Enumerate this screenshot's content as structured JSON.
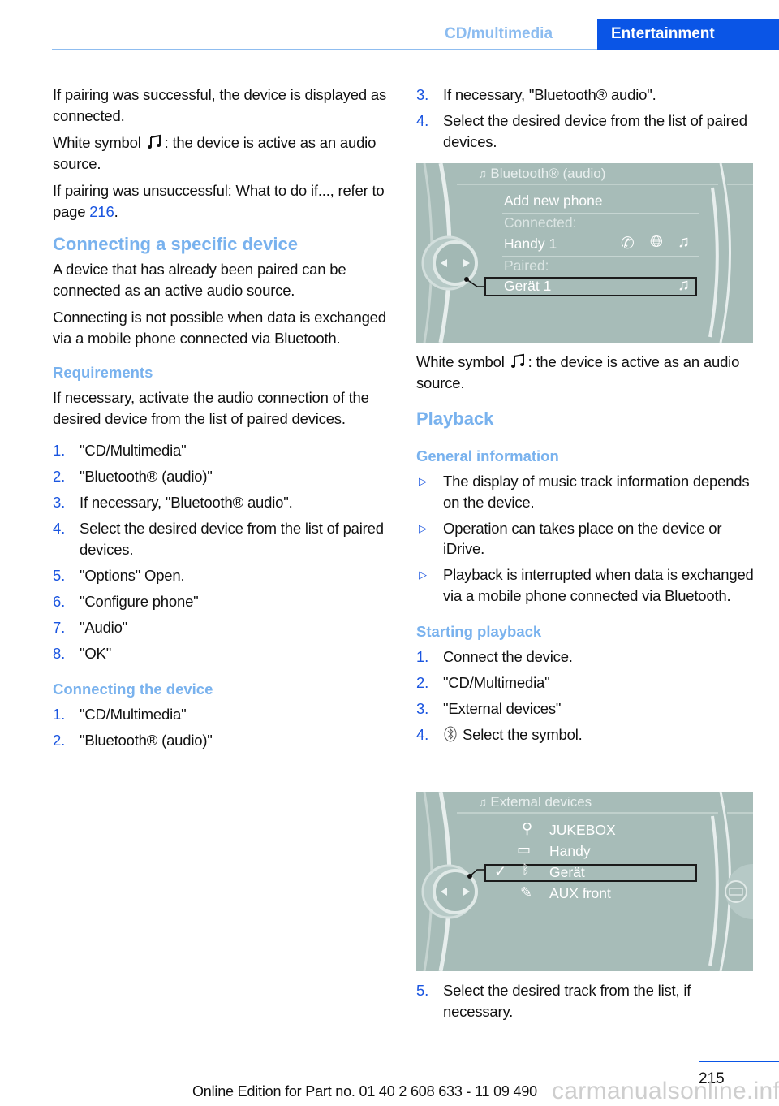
{
  "header": {
    "section": "CD/multimedia",
    "chapter_tab": "Entertainment"
  },
  "left": {
    "p1": "If pairing was successful, the device is displayed as connected.",
    "p2_before": "White symbol",
    "p2_after": ": the device is active as an audio source.",
    "p3_before": "If pairing was unsuccessful: What to do if..., refer to page ",
    "p3_link": "216",
    "p3_after": ".",
    "h_specific": "Connecting a specific device",
    "p4": "A device that has already been paired can be connected as an active audio source.",
    "p5": "Connecting is not possible when data is exchanged via a mobile phone connected via Bluetooth.",
    "h_requirements": "Requirements",
    "p6": "If necessary, activate the audio connection of the desired device from the list of paired devices.",
    "req_steps": [
      {
        "num": "1.",
        "text": "\"CD/Multimedia\""
      },
      {
        "num": "2.",
        "text": "\"Bluetooth® (audio)\""
      },
      {
        "num": "3.",
        "text": "If necessary, \"Bluetooth® audio\"."
      },
      {
        "num": "4.",
        "text": "Select the desired device from the list of paired devices."
      },
      {
        "num": "5.",
        "text": "\"Options\" Open."
      },
      {
        "num": "6.",
        "text": "\"Configure phone\""
      },
      {
        "num": "7.",
        "text": "\"Audio\""
      },
      {
        "num": "8.",
        "text": "\"OK\""
      }
    ],
    "h_connecting": "Connecting the device",
    "conn_steps": [
      {
        "num": "1.",
        "text": "\"CD/Multimedia\""
      },
      {
        "num": "2.",
        "text": "\"Bluetooth® (audio)\""
      }
    ]
  },
  "right": {
    "conn_steps_cont": [
      {
        "num": "3.",
        "text": "If necessary, \"Bluetooth® audio\"."
      },
      {
        "num": "4.",
        "text": "Select the desired device from the list of paired devices."
      }
    ],
    "screen1": {
      "title": "Bluetooth® (audio)",
      "add_new": "Add new phone",
      "connected_label": "Connected:",
      "connected_device": "Handy 1",
      "paired_label": "Paired:",
      "paired_device": "Gerät 1"
    },
    "p_white_before": "White symbol",
    "p_white_after": ": the device is active as an audio source.",
    "h_playback": "Playback",
    "h_general": "General information",
    "bullets": [
      "The display of music track information depends on the device.",
      "Operation can takes place on the device or iDrive.",
      "Playback is interrupted when data is exchanged via a mobile phone connected via Bluetooth."
    ],
    "h_starting": "Starting playback",
    "start_steps": [
      {
        "num": "1.",
        "text": "Connect the device."
      },
      {
        "num": "2.",
        "text": "\"CD/Multimedia\""
      },
      {
        "num": "3.",
        "text": "\"External devices\""
      },
      {
        "num": "4.",
        "text": "Select the symbol."
      }
    ],
    "screen2": {
      "title": "External devices",
      "items": [
        "JUKEBOX",
        "Handy",
        "Gerät",
        "AUX front"
      ]
    },
    "final_steps": [
      {
        "num": "5.",
        "text": "Select the desired track from the list, if necessary."
      }
    ]
  },
  "footer": {
    "page_number": "215",
    "edition": "Online Edition for Part no. 01 40 2 608 633 - 11 09 490",
    "watermark": "carmanualsonline.info"
  }
}
